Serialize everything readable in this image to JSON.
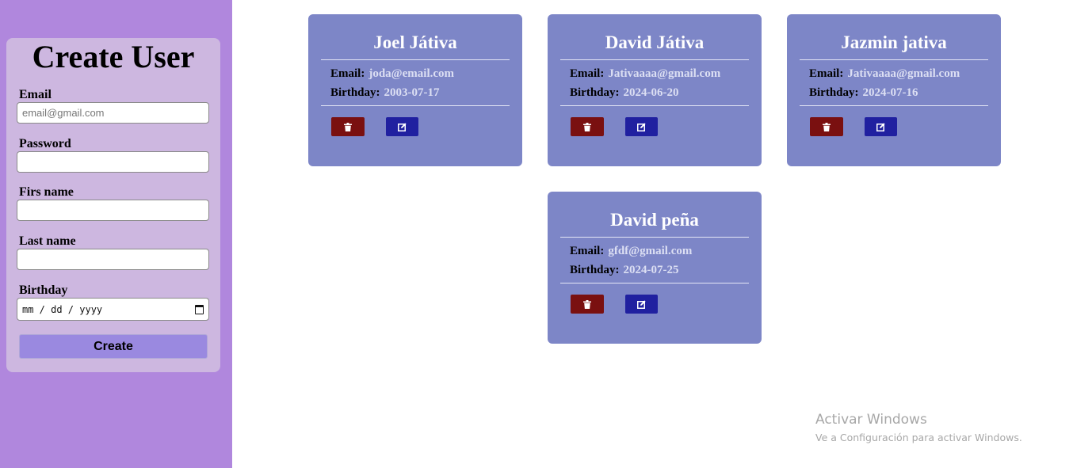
{
  "form": {
    "title": "Create User",
    "email_label": "Email",
    "email_placeholder": "email@gmail.com",
    "email_value": "",
    "password_label": "Password",
    "password_value": "",
    "first_name_label": "Firs name",
    "first_name_value": "",
    "last_name_label": "Last name",
    "last_name_value": "",
    "birthday_label": "Birthday",
    "birthday_placeholder": "mm / dd / yyyy",
    "create_label": "Create"
  },
  "cards": [
    {
      "name": "Joel Játiva",
      "email_label": "Email:",
      "email": "joda@email.com",
      "birthday_label": "Birthday:",
      "birthday": "2003-07-17"
    },
    {
      "name": "David Játiva",
      "email_label": "Email:",
      "email": "Jativaaaa@gmail.com",
      "birthday_label": "Birthday:",
      "birthday": "2024-06-20"
    },
    {
      "name": "Jazmin jativa",
      "email_label": "Email:",
      "email": "Jativaaaa@gmail.com",
      "birthday_label": "Birthday:",
      "birthday": "2024-07-16"
    },
    {
      "name": "David peña",
      "email_label": "Email:",
      "email": "gfdf@gmail.com",
      "birthday_label": "Birthday:",
      "birthday": "2024-07-25"
    }
  ],
  "icons": {
    "delete": "trash-icon",
    "edit": "edit-icon",
    "calendar": "calendar-icon"
  },
  "colors": {
    "sidebar": "#b087dd",
    "form_card": "#cdb7e0",
    "create_button": "#9a89e0",
    "user_card": "#7d86c7",
    "delete_button": "#7a1010",
    "edit_button": "#2020a0"
  },
  "watermark": {
    "title": "Activar Windows",
    "subtitle": "Ve a Configuración para activar Windows."
  }
}
